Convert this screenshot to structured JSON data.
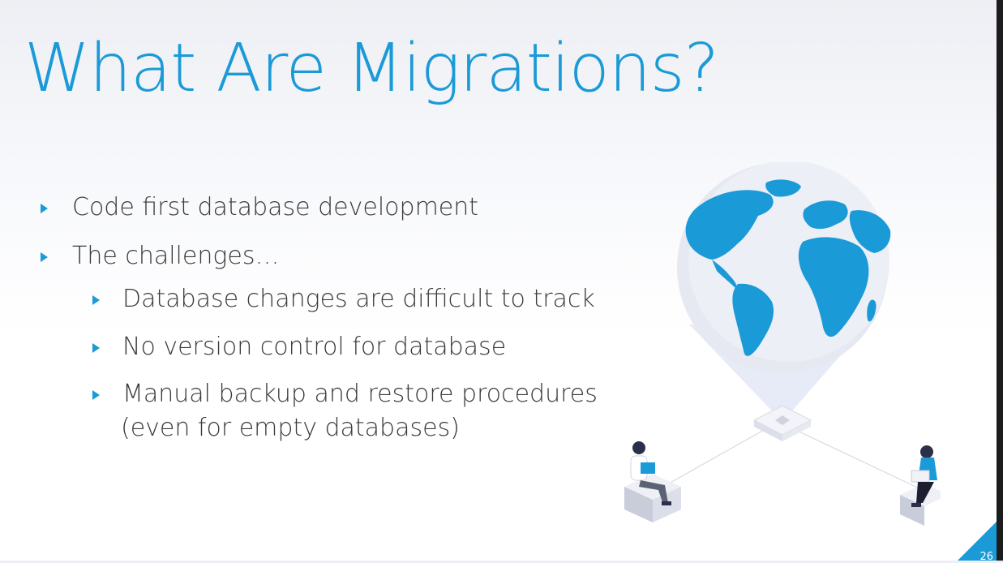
{
  "slide": {
    "title": "What Are Migrations?",
    "bullets": [
      {
        "text": "Code first database development",
        "level": 1
      },
      {
        "text": "The challenges…",
        "level": 1
      },
      {
        "text": "Database changes are difficult to track",
        "level": 2
      },
      {
        "text": "No version control for database",
        "level": 2
      },
      {
        "text": "Manual backup and restore procedures",
        "level": 2,
        "continuation": "(even for empty databases)"
      }
    ],
    "page_number": "26"
  },
  "colors": {
    "accent": "#1a9ad7",
    "text": "#3a3a3a",
    "globe_land": "#1a9ad7",
    "globe_sea": "#e6e8f2"
  },
  "illustration": {
    "icons": [
      "globe-icon",
      "person-with-laptop-icon",
      "person-with-laptop-icon"
    ]
  }
}
